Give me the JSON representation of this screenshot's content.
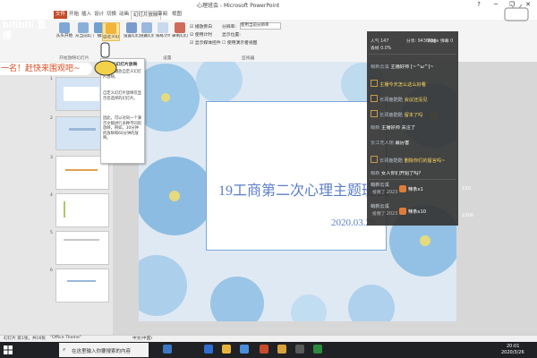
{
  "window": {
    "title": "心理班会 - Microsoft PowerPoint",
    "minimize_icon": "─",
    "restore_icon": "❐",
    "close_icon": "✕",
    "help_icon": "?"
  },
  "ribbon_tabs": [
    "文件",
    "开始",
    "插入",
    "设计",
    "切换",
    "动画",
    "幻灯片放映",
    "审阅",
    "视图"
  ],
  "ribbon": {
    "groups": [
      "开始放映幻灯片",
      "设置",
      "监视器"
    ],
    "buttons": {
      "from_start": "从头开始",
      "from_current": "从当前幻灯片开始",
      "broadcast": "广播幻灯片",
      "custom": "自定义幻灯片放映",
      "setup": "设置幻灯片放映",
      "hide": "隐藏幻灯片",
      "rehearse": "排练计时",
      "record": "录制幻灯片演示"
    },
    "checks": [
      "播放旁白",
      "使用计时",
      "显示媒体控件"
    ],
    "resolution_label": "分辨率:",
    "resolution_value": "使用当前分辨率",
    "show_on_label": "显示位置:",
    "presenter_view": "使用演示者视图"
  },
  "overlay": {
    "bili_logo": "bilibili 直播",
    "danmaku": "一名！赶快来围观吧~"
  },
  "tooltip": {
    "title": "自定义幻灯片放映",
    "lines": [
      "创建或播放自定义幻灯片放映。",
      "自定义幻灯片放映仅显示您选择的幻灯片。",
      "因此，可以对同一个演示文稿进行多种不同的放映，例如，30分钟的放映和60分钟的放映。"
    ]
  },
  "thumbnails": [
    {
      "num": "1"
    },
    {
      "num": "2"
    },
    {
      "num": "3"
    },
    {
      "num": "4"
    },
    {
      "num": "5"
    },
    {
      "num": "6"
    }
  ],
  "slide": {
    "title": "19工商第二次心理主题班会",
    "date": "2020.03.26"
  },
  "statusbar": {
    "slide_info": "幻灯片 第1张，共16张",
    "theme": "\"Office Theme\"",
    "language": "中文(中国)"
  },
  "taskbar": {
    "search_placeholder": "在这里输入你要搜索的内容",
    "time": "20:01",
    "date": "2020/3/26"
  },
  "live": {
    "viewers": "人气 147",
    "rank": "分享: 9436kbps",
    "net_labels": [
      "网络",
      "弹幕 0",
      "丢帧 0.0%"
    ],
    "chat": [
      {
        "user": "萌新云溪",
        "text": "主播好帅 [~^ω^]~"
      },
      {
        "user": "",
        "text": "主播今天怎么这么好看"
      },
      {
        "user": "长颈鹿酷酷",
        "text": "会议还没见"
      },
      {
        "user": "长颈鹿酷酷",
        "text": "留本了吗"
      },
      {
        "user": "萌新",
        "text": "主播好帅 关注了"
      },
      {
        "user": "长江无人侧",
        "text": "最厉害"
      },
      {
        "user": "长颈鹿酷酷",
        "text": "删除你们的留言吗~"
      },
      {
        "user": "萌新",
        "text": "女人你们开始了吗?"
      }
    ],
    "gifts": [
      {
        "user": "萌新云溪",
        "sub": "投喂了 2023",
        "gift": "辣条x1",
        "count": "100"
      },
      {
        "user": "萌新云溪",
        "sub": "投喂了 2023",
        "gift": "辣条x10",
        "count": "1000"
      }
    ]
  },
  "colors": {
    "accent": "#c44a2a",
    "slide_text": "#5b7ec9",
    "danmaku": "#d94b1f"
  }
}
